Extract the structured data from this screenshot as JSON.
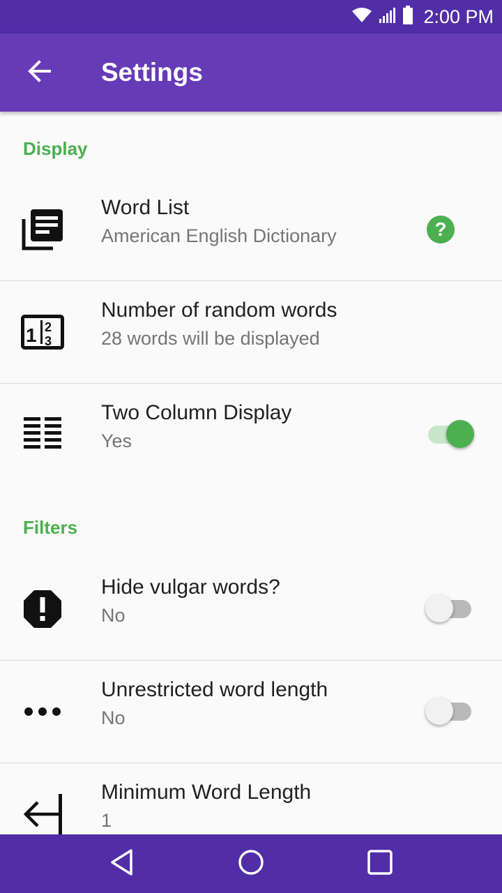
{
  "status_bar": {
    "time": "2:00 PM"
  },
  "app_bar": {
    "title": "Settings",
    "back_icon": "arrow-back-icon"
  },
  "sections": [
    {
      "header": "Display",
      "items": [
        {
          "title": "Word List",
          "summary": "American English Dictionary",
          "icon": "library-books-icon",
          "widget": "help"
        },
        {
          "title": "Number of random words",
          "summary": "28 words will be displayed",
          "icon": "numbers-icon",
          "widget": "none"
        },
        {
          "title": "Two Column Display",
          "summary": "Yes",
          "icon": "two-column-list-icon",
          "widget": "switch",
          "checked": true
        }
      ]
    },
    {
      "header": "Filters",
      "items": [
        {
          "title": "Hide vulgar words?",
          "summary": "No",
          "icon": "alert-octagon-icon",
          "widget": "switch",
          "checked": false
        },
        {
          "title": "Unrestricted word length",
          "summary": "No",
          "icon": "more-horizontal-icon",
          "widget": "switch",
          "checked": false
        },
        {
          "title": "Minimum Word Length",
          "summary": "1",
          "icon": "arrow-left-bar-icon",
          "widget": "none"
        }
      ]
    }
  ],
  "colors": {
    "status_bar": "#512da8",
    "app_bar": "#673ab7",
    "accent": "#4caf50",
    "background": "#fafafa"
  },
  "nav_bar": {
    "buttons": [
      "back-triangle-icon",
      "home-circle-icon",
      "recents-square-icon"
    ]
  }
}
